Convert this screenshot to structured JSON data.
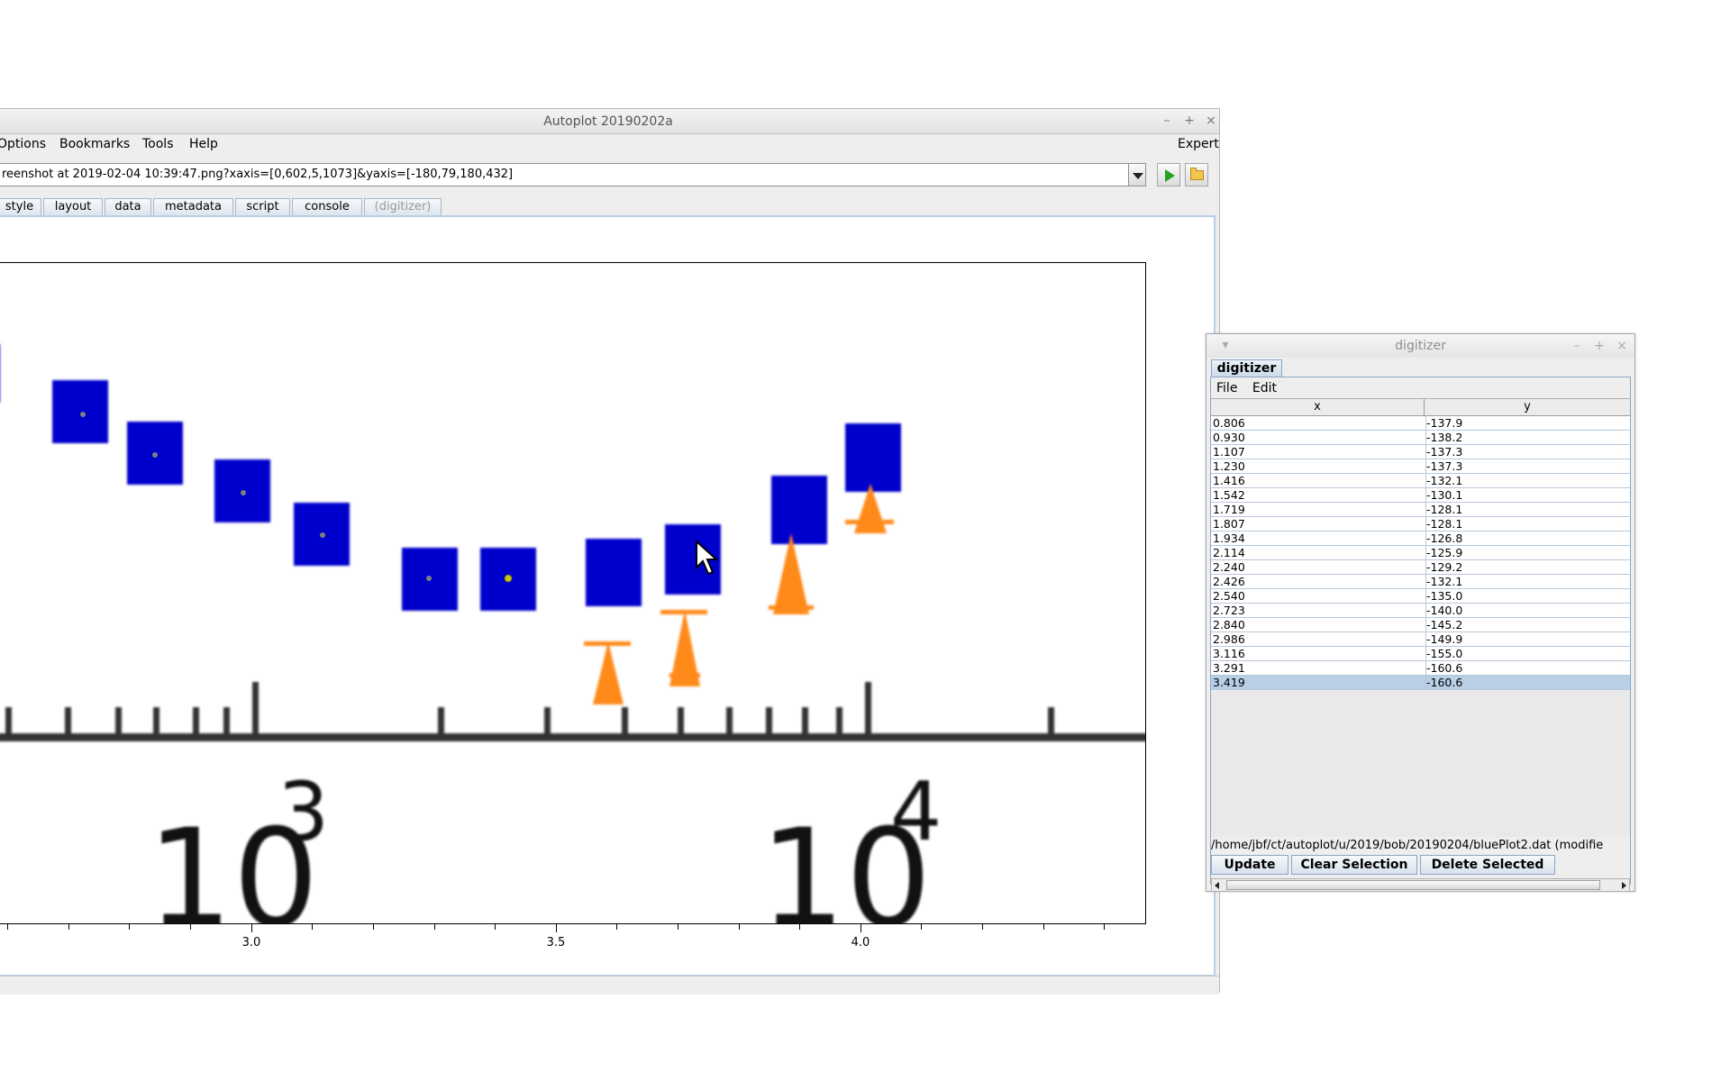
{
  "main_window": {
    "title": "Autoplot 20190202a",
    "menu": [
      "Options",
      "Bookmarks",
      "Tools",
      "Help"
    ],
    "expert_label": "Expert",
    "url_value": "reenshot at 2019-02-04 10:39:47.png?xaxis=[0,602,5,1073]&yaxis=[-180,79,180,432]",
    "tabs": [
      "style",
      "layout",
      "data",
      "metadata",
      "script",
      "console",
      "(digitizer)"
    ],
    "x_axis": {
      "scale": "linear",
      "tick_labels": [
        "3.0",
        "3.5",
        "4.0"
      ]
    },
    "background_image": {
      "text_labels": [
        "10",
        "3",
        "10",
        "4"
      ],
      "colors": {
        "blue_marker": "#0000cc",
        "orange_marker": "#ff8a1a",
        "axis_line": "#333333"
      }
    }
  },
  "digitizer": {
    "title": "digitizer",
    "tab": "digitizer",
    "menu": [
      "File",
      "Edit"
    ],
    "columns": [
      "x",
      "y"
    ],
    "rows": [
      [
        "0.806",
        "-137.9"
      ],
      [
        "0.930",
        "-138.2"
      ],
      [
        "1.107",
        "-137.3"
      ],
      [
        "1.230",
        "-137.3"
      ],
      [
        "1.416",
        "-132.1"
      ],
      [
        "1.542",
        "-130.1"
      ],
      [
        "1.719",
        "-128.1"
      ],
      [
        "1.807",
        "-128.1"
      ],
      [
        "1.934",
        "-126.8"
      ],
      [
        "2.114",
        "-125.9"
      ],
      [
        "2.240",
        "-129.2"
      ],
      [
        "2.426",
        "-132.1"
      ],
      [
        "2.540",
        "-135.0"
      ],
      [
        "2.723",
        "-140.0"
      ],
      [
        "2.840",
        "-145.2"
      ],
      [
        "2.986",
        "-149.9"
      ],
      [
        "3.116",
        "-155.0"
      ],
      [
        "3.291",
        "-160.6"
      ],
      [
        "3.419",
        "-160.6"
      ]
    ],
    "selected_row": "3.419",
    "file_path": "/home/jbf/ct/autoplot/u/2019/bob/20190204/bluePlot2.dat (modifie",
    "buttons": [
      "Update",
      "Clear Selection",
      "Delete Selected"
    ],
    "selection_color": "#b8cfe5"
  }
}
